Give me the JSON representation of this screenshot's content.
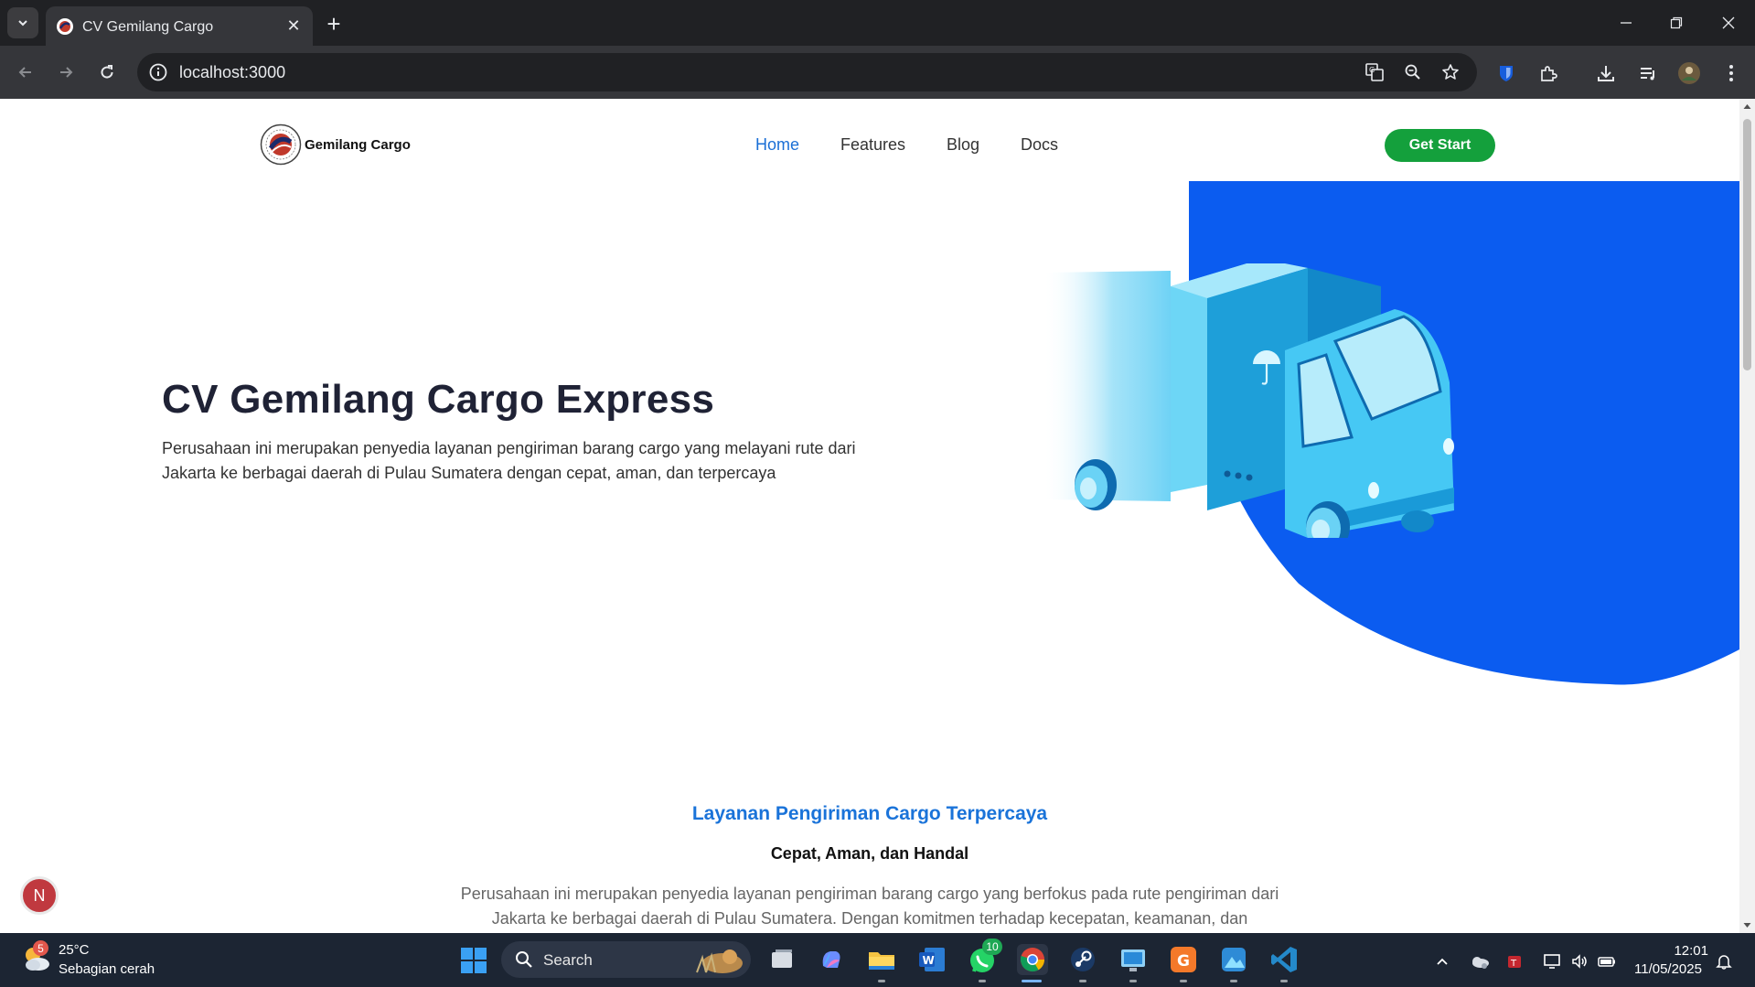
{
  "browser": {
    "tab_title": "CV Gemilang Cargo",
    "url": "localhost:3000"
  },
  "site": {
    "brand": "Gemilang Cargo",
    "nav": [
      {
        "label": "Home",
        "active": true
      },
      {
        "label": "Features",
        "active": false
      },
      {
        "label": "Blog",
        "active": false
      },
      {
        "label": "Docs",
        "active": false
      }
    ],
    "cta": "Get Start",
    "hero": {
      "title": "CV Gemilang Cargo Express",
      "description": "Perusahaan ini merupakan penyedia layanan pengiriman barang cargo yang melayani rute dari Jakarta ke berbagai daerah di Pulau Sumatera dengan cepat, aman, dan terpercaya"
    },
    "section": {
      "title": "Layanan Pengiriman Cargo Terpercaya",
      "subtitle": "Cepat, Aman, dan Handal",
      "description": "Perusahaan ini merupakan penyedia layanan pengiriman barang cargo yang berfokus pada rute pengiriman dari Jakarta ke berbagai daerah di Pulau Sumatera. Dengan komitmen terhadap kecepatan, keamanan, dan"
    },
    "fab_letter": "N"
  },
  "taskbar": {
    "weather_badge": "5",
    "temperature": "25°C",
    "weather": "Sebagian cerah",
    "search_label": "Search",
    "whatsapp_badge": "10",
    "time": "12:01",
    "date": "11/05/2025"
  },
  "colors": {
    "accent_blue": "#0b5cf0",
    "nav_active": "#1a6fd6",
    "cta_green": "#14a03c",
    "title_dark": "#1f2235"
  }
}
